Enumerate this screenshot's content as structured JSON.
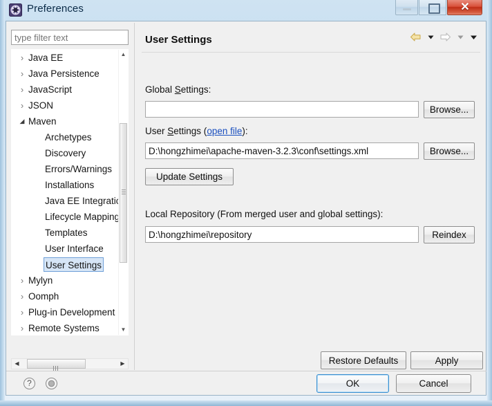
{
  "window": {
    "title": "Preferences",
    "icon": "preferences-gear-icon",
    "controls": {
      "minimize_label": "Minimize",
      "maximize_label": "Restore",
      "close_label": "Close",
      "close_glyph": "✕"
    }
  },
  "sidebar": {
    "filter": {
      "value": "",
      "placeholder": "type filter text"
    },
    "tree": [
      {
        "label": "Java EE",
        "level": 1,
        "twisty": "collapsed",
        "selected": false
      },
      {
        "label": "Java Persistence",
        "level": 1,
        "twisty": "collapsed",
        "selected": false
      },
      {
        "label": "JavaScript",
        "level": 1,
        "twisty": "collapsed",
        "selected": false
      },
      {
        "label": "JSON",
        "level": 1,
        "twisty": "collapsed",
        "selected": false
      },
      {
        "label": "Maven",
        "level": 1,
        "twisty": "expanded",
        "selected": false
      },
      {
        "label": "Archetypes",
        "level": 2,
        "twisty": "none",
        "selected": false
      },
      {
        "label": "Discovery",
        "level": 2,
        "twisty": "none",
        "selected": false
      },
      {
        "label": "Errors/Warnings",
        "level": 2,
        "twisty": "none",
        "selected": false
      },
      {
        "label": "Installations",
        "level": 2,
        "twisty": "none",
        "selected": false
      },
      {
        "label": "Java EE Integration",
        "level": 2,
        "twisty": "none",
        "selected": false
      },
      {
        "label": "Lifecycle Mappings",
        "level": 2,
        "twisty": "none",
        "selected": false
      },
      {
        "label": "Templates",
        "level": 2,
        "twisty": "none",
        "selected": false
      },
      {
        "label": "User Interface",
        "level": 2,
        "twisty": "none",
        "selected": false
      },
      {
        "label": "User Settings",
        "level": 2,
        "twisty": "none",
        "selected": true
      },
      {
        "label": "Mylyn",
        "level": 1,
        "twisty": "collapsed",
        "selected": false
      },
      {
        "label": "Oomph",
        "level": 1,
        "twisty": "collapsed",
        "selected": false
      },
      {
        "label": "Plug-in Development",
        "level": 1,
        "twisty": "collapsed",
        "selected": false
      },
      {
        "label": "Remote Systems",
        "level": 1,
        "twisty": "collapsed",
        "selected": false
      }
    ],
    "scroll": {
      "up_glyph": "▲",
      "down_glyph": "▼",
      "left_glyph": "◀",
      "right_glyph": "▶"
    }
  },
  "page": {
    "title": "User Settings",
    "nav": {
      "back_icon": "back-arrow-icon",
      "back_menu_icon": "chevron-down-icon",
      "forward_icon": "forward-arrow-icon",
      "forward_menu_icon": "chevron-down-icon",
      "view_menu_icon": "chevron-down-icon",
      "chevron_glyph": "▼"
    },
    "global_settings": {
      "label_before": "Global ",
      "label_mnemonic": "S",
      "label_after": "ettings:",
      "value": "",
      "browse_label": "Browse..."
    },
    "user_settings": {
      "label_before": "User ",
      "label_mnemonic": "S",
      "label_mid": "ettings (",
      "link_label": "open file",
      "label_after": "):",
      "value": "D:\\hongzhimei\\apache-maven-3.2.3\\conf\\settings.xml",
      "browse_label": "Browse..."
    },
    "update_settings_label": "Update Settings",
    "local_repository": {
      "label": "Local Repository (From merged user and global settings):",
      "value": "D:\\hongzhimei\\repository",
      "reindex_label": "Reindex"
    },
    "restore_defaults_label": "Restore Defaults",
    "apply_label": "Apply"
  },
  "footer": {
    "help_icon": "help-question-icon",
    "help_glyph": "?",
    "keyword_icon": "keyword-dot-icon",
    "ok_label": "OK",
    "cancel_label": "Cancel"
  },
  "colors": {
    "accent_blue": "#3b8fd0",
    "link_blue": "#1a4fbf",
    "selection_fill": "#d6e5f6",
    "selection_border": "#6fa0d8",
    "close_red": "#bf2d16",
    "nav_back_yellow": "#e8cf7a",
    "dialog_bg": "#f0f0f0"
  }
}
